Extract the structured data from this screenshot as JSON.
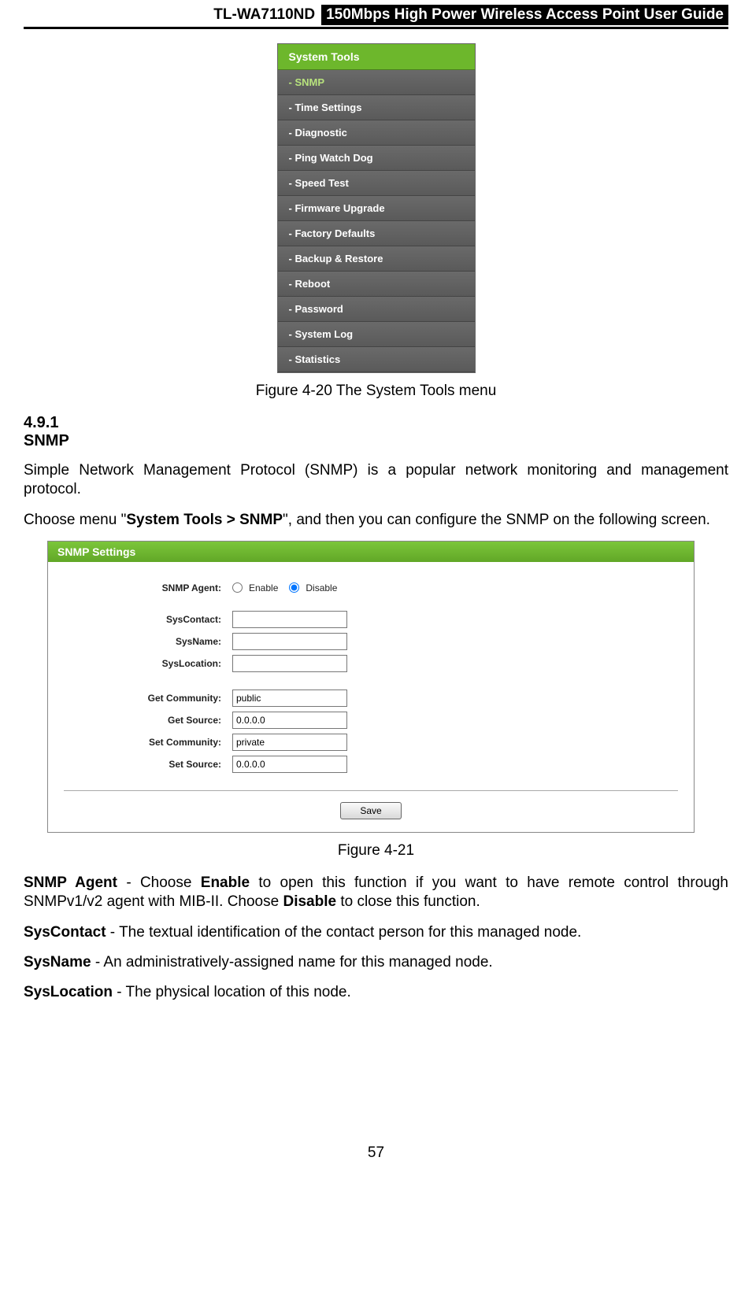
{
  "header": {
    "model": "TL-WA7110ND",
    "title": "150Mbps High Power Wireless Access Point User Guide"
  },
  "nav_menu": {
    "title": "System Tools",
    "items": [
      {
        "label": "- SNMP",
        "selected": true
      },
      {
        "label": "- Time Settings",
        "selected": false
      },
      {
        "label": "- Diagnostic",
        "selected": false
      },
      {
        "label": "- Ping Watch Dog",
        "selected": false
      },
      {
        "label": "- Speed Test",
        "selected": false
      },
      {
        "label": "- Firmware Upgrade",
        "selected": false
      },
      {
        "label": "- Factory Defaults",
        "selected": false
      },
      {
        "label": "- Backup & Restore",
        "selected": false
      },
      {
        "label": "- Reboot",
        "selected": false
      },
      {
        "label": "- Password",
        "selected": false
      },
      {
        "label": "- System Log",
        "selected": false
      },
      {
        "label": "- Statistics",
        "selected": false
      }
    ]
  },
  "figure1_caption": "Figure 4-20 The System Tools menu",
  "section": {
    "number": "4.9.1",
    "title": "SNMP"
  },
  "para1": "Simple Network Management Protocol (SNMP) is a popular network monitoring and management protocol.",
  "para2_a": "Choose menu \"",
  "para2_b": "System Tools > SNMP",
  "para2_c": "\", and then you can configure the SNMP on the following screen.",
  "snmp_panel": {
    "title": "SNMP Settings",
    "agent_label": "SNMP Agent:",
    "enable": "Enable",
    "disable": "Disable",
    "sys_contact_label": "SysContact:",
    "sys_name_label": "SysName:",
    "sys_location_label": "SysLocation:",
    "get_community_label": "Get Community:",
    "get_community_value": "public",
    "get_source_label": "Get Source:",
    "get_source_value": "0.0.0.0",
    "set_community_label": "Set Community:",
    "set_community_value": "private",
    "set_source_label": "Set Source:",
    "set_source_value": "0.0.0.0",
    "save": "Save"
  },
  "figure2_caption": "Figure 4-21",
  "desc": {
    "snmp_agent_term": "SNMP Agent",
    "snmp_agent_a": " - Choose ",
    "snmp_agent_enable": "Enable",
    "snmp_agent_b": " to open this function if you want to have remote control through SNMPv1/v2 agent with MIB-II. Choose ",
    "snmp_agent_disable": "Disable",
    "snmp_agent_c": " to close this function.",
    "syscontact_term": "SysContact",
    "syscontact_a": " - The textual identification of the contact person for this managed node.",
    "sysname_term": "SysName",
    "sysname_a": " - An administratively-assigned name for this managed node.",
    "syslocation_term": "SysLocation",
    "syslocation_a": " - The physical location of this node."
  },
  "page_number": "57"
}
